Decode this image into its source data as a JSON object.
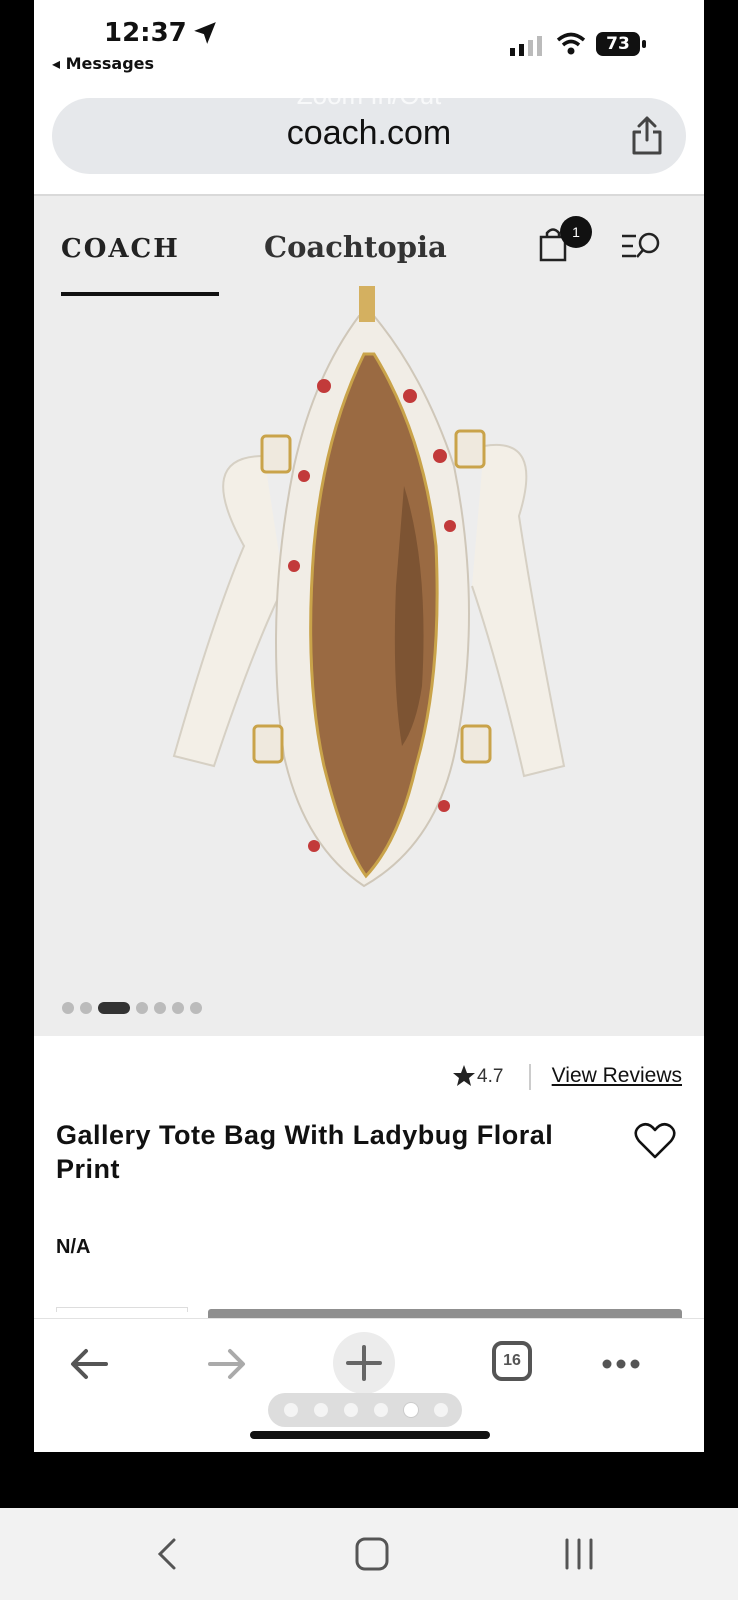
{
  "status_bar": {
    "time": "12:37",
    "back_label": "◂ Messages",
    "battery": "73"
  },
  "browser": {
    "overlay_hint": "Zoom In/Out",
    "domain": "coach.com"
  },
  "site_header": {
    "brand": "COACH",
    "sub_brand": "Coachtopia",
    "cart_count": "1"
  },
  "gallery": {
    "image_count": 7,
    "active_index": 2
  },
  "product": {
    "rating": "4.7",
    "reviews_link": "View Reviews",
    "title": "Gallery Tote Bag With Ladybug Floral Print",
    "price": "N/A"
  },
  "toolbar": {
    "tab_count": "16",
    "page_dots": 6,
    "active_page": 4
  },
  "colors": {
    "hero_bg": "#ededed",
    "lining": "#9a6a42",
    "canvas": "#f1ede6",
    "accent_dark": "#111111"
  }
}
